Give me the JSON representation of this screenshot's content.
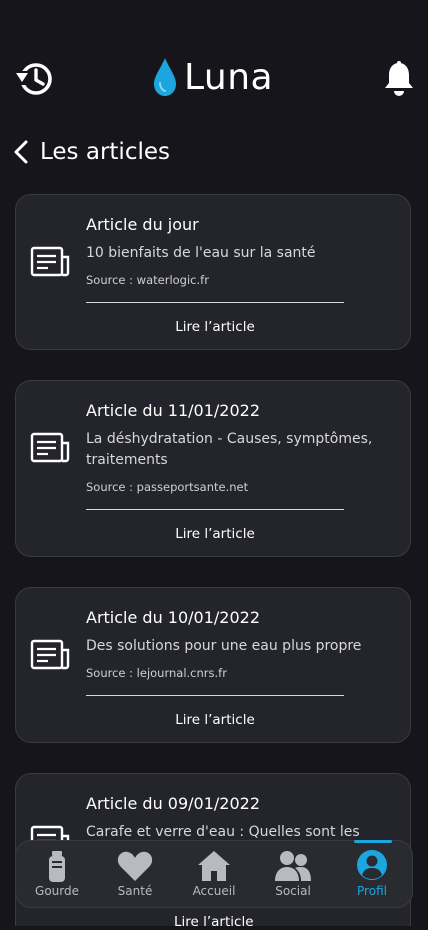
{
  "app": {
    "name": "Luna"
  },
  "header": {
    "title": "Les articles"
  },
  "articles": [
    {
      "title": "Article du jour",
      "description": "10 bienfaits de l'eau sur la santé",
      "source": "Source : waterlogic.fr",
      "link_label": "Lire l’article"
    },
    {
      "title": "Article du 11/01/2022",
      "description": "La déshydratation - Causes, symptômes, traitements",
      "source": "Source : passeportsante.net",
      "link_label": "Lire l’article"
    },
    {
      "title": "Article du 10/01/2022",
      "description": "Des solutions pour une eau plus propre",
      "source": "Source : lejournal.cnrs.fr",
      "link_label": "Lire l’article"
    },
    {
      "title": "Article du 09/01/2022",
      "description": "Carafe et verre d'eau : Quelles sont les",
      "link_label": "Lire l’article"
    }
  ],
  "nav": {
    "items": [
      {
        "label": "Gourde",
        "icon": "bottle-icon"
      },
      {
        "label": "Santé",
        "icon": "heart-icon"
      },
      {
        "label": "Accueil",
        "icon": "home-icon"
      },
      {
        "label": "Social",
        "icon": "users-icon"
      },
      {
        "label": "Profil",
        "icon": "profile-icon"
      }
    ],
    "active": "Profil"
  },
  "colors": {
    "background": "#15151b",
    "card": "#24252c",
    "accent": "#1ca6df",
    "drop": "#1ca6df"
  }
}
